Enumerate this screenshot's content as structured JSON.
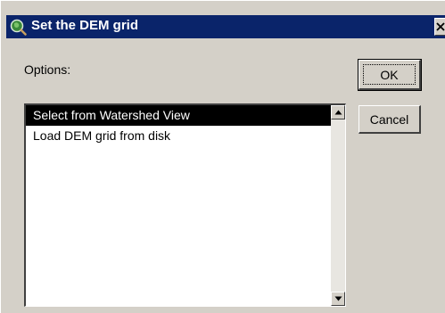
{
  "window": {
    "title": "Set the DEM grid",
    "app_icon": "globe-magnifier-icon",
    "close_icon": "close-icon"
  },
  "options": {
    "label": "Options:",
    "items": [
      {
        "label": "Select from Watershed View",
        "selected": true
      },
      {
        "label": "Load DEM grid from disk",
        "selected": false
      }
    ]
  },
  "buttons": {
    "ok_label": "OK",
    "cancel_label": "Cancel"
  },
  "colors": {
    "titlebar": "#0a246a",
    "dialog_face": "#d4d0c8",
    "selection": "#000000"
  }
}
